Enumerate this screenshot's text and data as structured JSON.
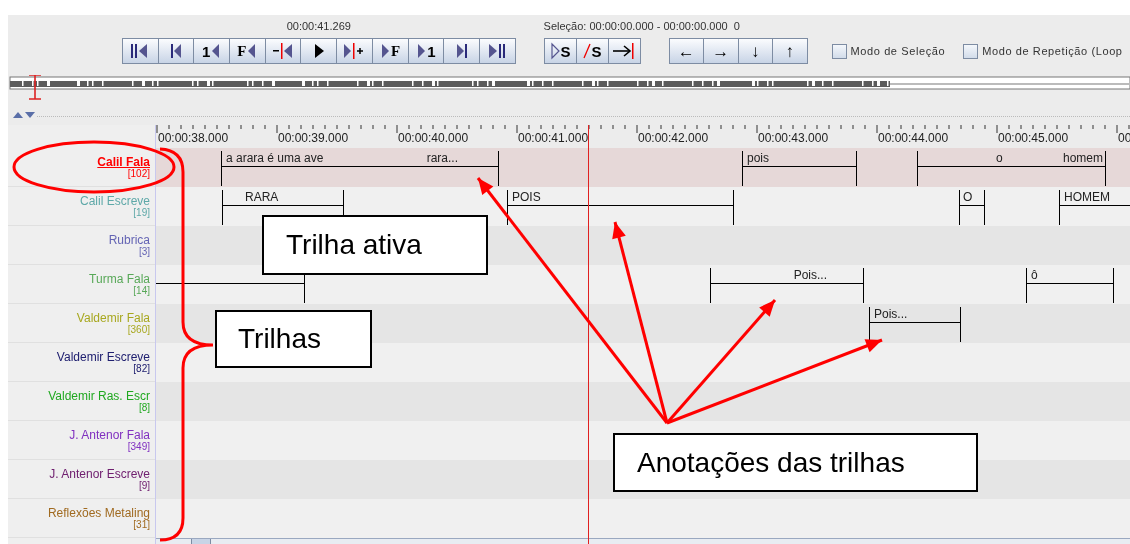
{
  "toolbar": {
    "time": "00:00:41.269",
    "selection": "Seleção: 00:00:00.000 - 00:00:00.000  0",
    "player_buttons": [
      {
        "kind": "begin"
      },
      {
        "kind": "prev-frame"
      },
      {
        "kind": "prev-label",
        "label": "1"
      },
      {
        "kind": "prev-label-serif",
        "label": "F"
      },
      {
        "kind": "prev-sel"
      },
      {
        "kind": "play"
      },
      {
        "kind": "next-sel"
      },
      {
        "kind": "next-label-serif",
        "label": "F"
      },
      {
        "kind": "next-label",
        "label": "1"
      },
      {
        "kind": "next-frame"
      },
      {
        "kind": "end"
      }
    ],
    "selection_buttons": [
      {
        "kind": "play-sel",
        "label": "S"
      },
      {
        "kind": "clear-sel",
        "label": "S"
      },
      {
        "kind": "to-sel"
      }
    ],
    "arrow_buttons": [
      {
        "label": "←"
      },
      {
        "label": "→"
      },
      {
        "label": "↓"
      },
      {
        "label": "↑"
      }
    ],
    "checkboxes": [
      {
        "label": "Modo de Seleção",
        "checked": false
      },
      {
        "label": "Modo de Repetição (Loop",
        "checked": false
      }
    ]
  },
  "ruler": {
    "ticks": [
      "00:00:38.000",
      "00:00:39.000",
      "00:00:40.000",
      "00:00:41.000",
      "00:00:42.000",
      "00:00:43.000",
      "00:00:44.000",
      "00:00:45.000",
      "00"
    ]
  },
  "tracks": [
    {
      "name": "Calil Fala",
      "count": "[102]",
      "color": "#ff0000",
      "selected": true,
      "annotations": [
        {
          "kind": "text",
          "texts": [
            "a arara é uma ave",
            "rara..."
          ]
        },
        {
          "kind": "text",
          "texts": [
            "pois"
          ]
        },
        {
          "kind": "text",
          "texts": [
            "o",
            "homem"
          ]
        }
      ]
    },
    {
      "name": "Calil Escreve",
      "count": "[19]",
      "color": "#5ea8a8",
      "selected": false,
      "annotations": [
        {
          "kind": "text",
          "texts": [
            "RARA"
          ]
        },
        {
          "kind": "text",
          "texts": [
            "POIS"
          ]
        },
        {
          "kind": "text",
          "texts": [
            "O"
          ]
        },
        {
          "kind": "text",
          "texts": [
            "HOMEM"
          ]
        }
      ]
    },
    {
      "name": "Rubrica",
      "count": "[3]",
      "color": "#6464b4",
      "selected": false
    },
    {
      "name": "Turma Fala",
      "count": "[14]",
      "color": "#58a858",
      "selected": false,
      "annotations": [
        {
          "kind": "empty"
        },
        {
          "kind": "text",
          "texts": [
            "Pois..."
          ]
        },
        {
          "kind": "text",
          "texts": [
            "ô"
          ]
        }
      ]
    },
    {
      "name": "Valdemir Fala",
      "count": "[360]",
      "color": "#a8a820",
      "selected": false,
      "annotations": [
        {
          "kind": "text",
          "texts": [
            "Pois..."
          ]
        }
      ]
    },
    {
      "name": "Valdemir Escreve",
      "count": "[82]",
      "color": "#202070",
      "selected": false
    },
    {
      "name": "Valdemir Ras. Escr",
      "count": "[8]",
      "color": "#20a820",
      "selected": false
    },
    {
      "name": "J. Antenor Fala",
      "count": "[349]",
      "color": "#8030c0",
      "selected": false
    },
    {
      "name": "J. Antenor Escreve",
      "count": "[9]",
      "color": "#702070",
      "selected": false
    },
    {
      "name": "Reflexões Metaling",
      "count": "[31]",
      "color": "#a06a20",
      "selected": false
    }
  ],
  "callouts": [
    {
      "text": "Trilha ativa"
    },
    {
      "text": "Trilhas"
    },
    {
      "text": "Anotações das trilhas"
    }
  ]
}
